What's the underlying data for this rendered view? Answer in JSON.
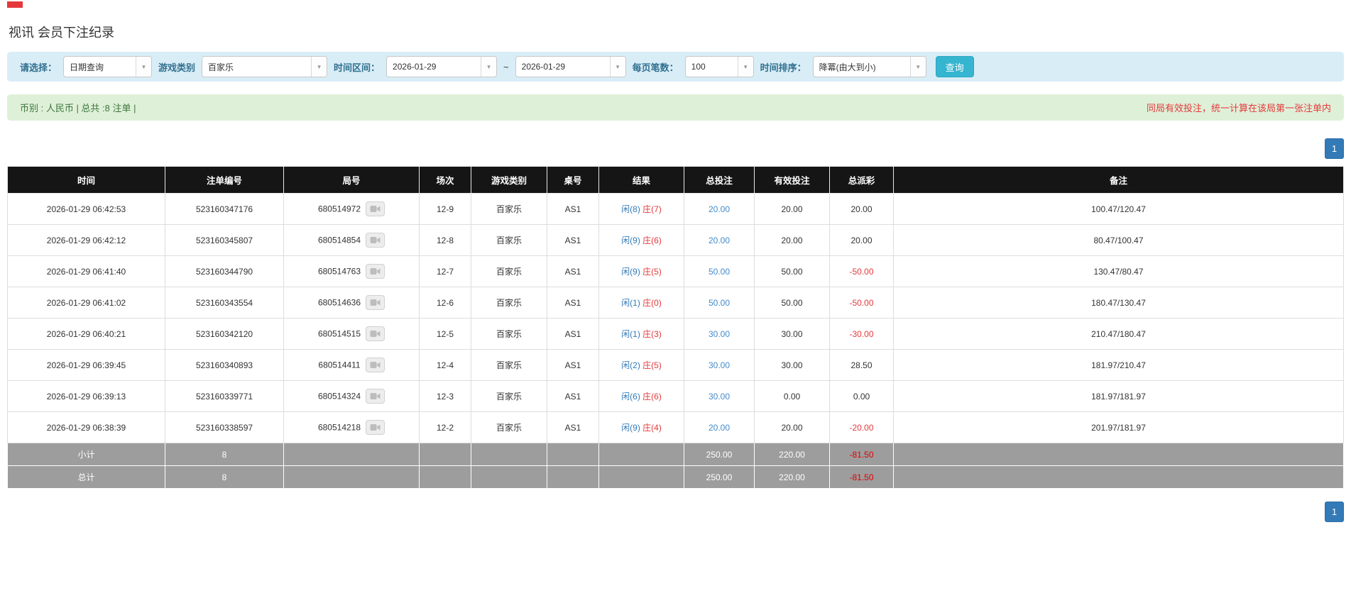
{
  "page": {
    "title": "视讯 会员下注纪录"
  },
  "filters": {
    "select_label": "请选择：",
    "select_value": "日期查询",
    "game_label": "游戏类别",
    "game_value": "百家乐",
    "range_label": "时间区间：",
    "date_from": "2026-01-29",
    "range_sep": "~",
    "date_to": "2026-01-29",
    "per_page_label": "每页笔数：",
    "per_page_value": "100",
    "sort_label": "时间排序：",
    "sort_value": "降冪(由大到小)",
    "search_button": "查询"
  },
  "summary": {
    "left": "币别 : 人民币 | 总共 :8 注单 |",
    "right": "同局有效投注，统一计算在该局第一张注单内"
  },
  "pagination": {
    "page": "1"
  },
  "table": {
    "headers": [
      "时间",
      "注单编号",
      "局号",
      "场次",
      "游戏类别",
      "桌号",
      "结果",
      "总投注",
      "有效投注",
      "总派彩",
      "备注"
    ],
    "rows": [
      {
        "time": "2026-01-29 06:42:53",
        "bet_id": "523160347176",
        "round": "680514972",
        "session": "12-9",
        "game": "百家乐",
        "table": "AS1",
        "result": {
          "player": "闲(8)",
          "banker": "庄(7)"
        },
        "total_bet": "20.00",
        "valid_bet": "20.00",
        "payout": "20.00",
        "note": "100.47/120.47"
      },
      {
        "time": "2026-01-29 06:42:12",
        "bet_id": "523160345807",
        "round": "680514854",
        "session": "12-8",
        "game": "百家乐",
        "table": "AS1",
        "result": {
          "player": "闲(9)",
          "banker": "庄(6)"
        },
        "total_bet": "20.00",
        "valid_bet": "20.00",
        "payout": "20.00",
        "note": "80.47/100.47"
      },
      {
        "time": "2026-01-29 06:41:40",
        "bet_id": "523160344790",
        "round": "680514763",
        "session": "12-7",
        "game": "百家乐",
        "table": "AS1",
        "result": {
          "player": "闲(9)",
          "banker": "庄(5)"
        },
        "total_bet": "50.00",
        "valid_bet": "50.00",
        "payout": "-50.00",
        "note": "130.47/80.47"
      },
      {
        "time": "2026-01-29 06:41:02",
        "bet_id": "523160343554",
        "round": "680514636",
        "session": "12-6",
        "game": "百家乐",
        "table": "AS1",
        "result": {
          "player": "闲(1)",
          "banker": "庄(0)"
        },
        "total_bet": "50.00",
        "valid_bet": "50.00",
        "payout": "-50.00",
        "note": "180.47/130.47"
      },
      {
        "time": "2026-01-29 06:40:21",
        "bet_id": "523160342120",
        "round": "680514515",
        "session": "12-5",
        "game": "百家乐",
        "table": "AS1",
        "result": {
          "player": "闲(1)",
          "banker": "庄(3)"
        },
        "total_bet": "30.00",
        "valid_bet": "30.00",
        "payout": "-30.00",
        "note": "210.47/180.47"
      },
      {
        "time": "2026-01-29 06:39:45",
        "bet_id": "523160340893",
        "round": "680514411",
        "session": "12-4",
        "game": "百家乐",
        "table": "AS1",
        "result": {
          "player": "闲(2)",
          "banker": "庄(5)"
        },
        "total_bet": "30.00",
        "valid_bet": "30.00",
        "payout": "28.50",
        "note": "181.97/210.47"
      },
      {
        "time": "2026-01-29 06:39:13",
        "bet_id": "523160339771",
        "round": "680514324",
        "session": "12-3",
        "game": "百家乐",
        "table": "AS1",
        "result": {
          "player": "闲(6)",
          "banker": "庄(6)"
        },
        "total_bet": "30.00",
        "valid_bet": "0.00",
        "payout": "0.00",
        "note": "181.97/181.97"
      },
      {
        "time": "2026-01-29 06:38:39",
        "bet_id": "523160338597",
        "round": "680514218",
        "session": "12-2",
        "game": "百家乐",
        "table": "AS1",
        "result": {
          "player": "闲(9)",
          "banker": "庄(4)"
        },
        "total_bet": "20.00",
        "valid_bet": "20.00",
        "payout": "-20.00",
        "note": "201.97/181.97"
      }
    ],
    "subtotal": {
      "label": "小计",
      "count": "8",
      "total_bet": "250.00",
      "valid_bet": "220.00",
      "payout": "-81.50"
    },
    "total": {
      "label": "总计",
      "count": "8",
      "total_bet": "250.00",
      "valid_bet": "220.00",
      "payout": "-81.50"
    }
  }
}
